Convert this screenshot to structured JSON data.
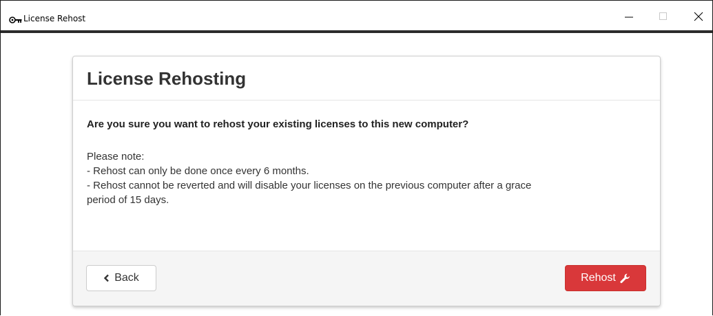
{
  "window": {
    "title": "License Rehost",
    "icon": "key-icon",
    "controls": {
      "minimize": "minimize-icon",
      "maximize": "maximize-icon",
      "close": "close-icon"
    }
  },
  "dialog": {
    "title": "License Rehosting",
    "question": "Are you sure you want to rehost your existing licenses to this new computer?",
    "note_lines": [
      "Please note:",
      "- Rehost can only be done once every 6 months.",
      "- Rehost cannot be reverted and will disable your licenses on the previous computer after a grace",
      "period of 15 days."
    ],
    "back_button": {
      "label": "Back",
      "icon": "chevron-left-icon"
    },
    "rehost_button": {
      "label": "Rehost",
      "icon": "wrench-icon",
      "color": "#d9383a"
    }
  }
}
